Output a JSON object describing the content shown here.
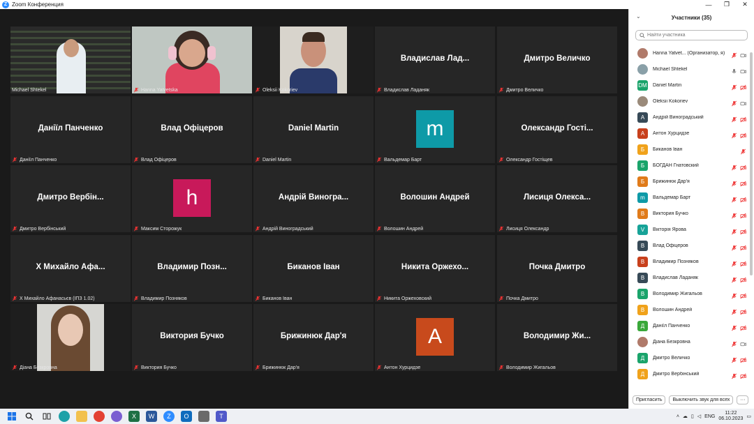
{
  "window": {
    "title": "Zoom Конференция",
    "controls": [
      "—",
      "❐",
      "✕"
    ]
  },
  "tiles": [
    {
      "name": "Michael Shtekel",
      "big": "",
      "photo": "mic-photo",
      "active": true
    },
    {
      "name": "Hanna Yatvetska",
      "big": "",
      "photo": "hanna-photo"
    },
    {
      "name": "Oleksii Kokoriev",
      "big": "",
      "photo": "oleksii-photo"
    },
    {
      "name": "Владислав Ладаняк",
      "big": "Владислав  Лад..."
    },
    {
      "name": "Дмитро Величко",
      "big": "Дмитро Величко"
    },
    {
      "name": "Даніїл Панченко",
      "big": "Даніїл Панченко"
    },
    {
      "name": "Влад Офіцеров",
      "big": "Влад Офіцеров"
    },
    {
      "name": "Daniel Martin",
      "big": "Daniel Martin"
    },
    {
      "name": "Вальдемар Барт",
      "big": "",
      "avatar": "m",
      "color": "#0e9aa7"
    },
    {
      "name": "Олександр Гостіщев",
      "big": "Олександр  Гості..."
    },
    {
      "name": "Дмитро Вербінський",
      "big": "Дмитро  Вербін..."
    },
    {
      "name": "Максим Сторожук",
      "big": "",
      "avatar": "h",
      "color": "#c8195a"
    },
    {
      "name": "Андрій Виноградський",
      "big": "Андрій  Виногра..."
    },
    {
      "name": "Волошин Андрей",
      "big": "Волошин Андрей"
    },
    {
      "name": "Лисиця Олександр",
      "big": "Лисиця  Олекса..."
    },
    {
      "name": "Х Михайло Афанасьєв (ІПЗ 1.02)",
      "big": "Х Михайло  Афа..."
    },
    {
      "name": "Владимир Позняков",
      "big": "Владимир  Позн..."
    },
    {
      "name": "Биканов Іван",
      "big": "Биканов Іван"
    },
    {
      "name": "Никита Оржеховский",
      "big": "Никита  Оржехо..."
    },
    {
      "name": "Почка Дмитро",
      "big": "Почка Дмитро"
    },
    {
      "name": "Діана Безкровна",
      "big": "",
      "photo": "diana-photo"
    },
    {
      "name": "Виктория Бучко",
      "big": "Виктория Бучко"
    },
    {
      "name": "Брижинюк Дар'я",
      "big": "Брижинюк Дар'я"
    },
    {
      "name": "Антон Хурцидзе",
      "big": "",
      "avatar": "A",
      "color": "#c84a1c"
    },
    {
      "name": "Володимир Жигальов",
      "big": "Володимир  Жи..."
    }
  ],
  "panel": {
    "title": "Участники (35)",
    "search_placeholder": "Найти участника",
    "participants": [
      {
        "name": "Hanna Yatvet...  (Организатор, я)",
        "av": "",
        "color": "#b07a6a",
        "photo": true
      },
      {
        "name": "Michael Shtekel",
        "av": "",
        "color": "#8aa0a8",
        "photo": true,
        "micOn": true
      },
      {
        "name": "Daniel Martin",
        "av": "DM",
        "color": "#1aa46b"
      },
      {
        "name": "Oleksii Kokoriev",
        "av": "",
        "color": "#9a8a7a",
        "photo": true
      },
      {
        "name": "Андрій Виноградський",
        "av": "А",
        "color": "#374a57"
      },
      {
        "name": "Антон Хурцидзе",
        "av": "А",
        "color": "#c8401c"
      },
      {
        "name": "Биканов Іван",
        "av": "Б",
        "color": "#f0a21b",
        "noVideo": true
      },
      {
        "name": "БОГДАН Гнатовский",
        "av": "Б",
        "color": "#1aa46b"
      },
      {
        "name": "Брижинюк Дар'я",
        "av": "Б",
        "color": "#e07b1a"
      },
      {
        "name": "Вальдемар Барт",
        "av": "m",
        "color": "#0e9aa7"
      },
      {
        "name": "Виктория Бучко",
        "av": "В",
        "color": "#e07b1a"
      },
      {
        "name": "Вікторія Ярова",
        "av": "V",
        "color": "#17a398"
      },
      {
        "name": "Влад Офіцеров",
        "av": "В",
        "color": "#374a57"
      },
      {
        "name": "Владимир Позняков",
        "av": "В",
        "color": "#c8401c"
      },
      {
        "name": "Владислав Ладаняк",
        "av": "В",
        "color": "#374a57"
      },
      {
        "name": "Володимир Жигальов",
        "av": "В",
        "color": "#1aa46b"
      },
      {
        "name": "Волошин Андрей",
        "av": "В",
        "color": "#f0a21b"
      },
      {
        "name": "Даніїл Панченко",
        "av": "Д",
        "color": "#3aa83a"
      },
      {
        "name": "Діана Безкровна",
        "av": "",
        "color": "#b07a6a",
        "photo": true
      },
      {
        "name": "Дмитро Величко",
        "av": "Д",
        "color": "#1aa46b"
      },
      {
        "name": "Дмитро Вербінський",
        "av": "Д",
        "color": "#f0a21b"
      }
    ],
    "invite_label": "Пригласить",
    "mute_all_label": "Выключить звук для всех",
    "more_label": "···"
  },
  "taskbar": {
    "lang": "ENG",
    "time": "11:22",
    "date": "06.10.2023"
  }
}
